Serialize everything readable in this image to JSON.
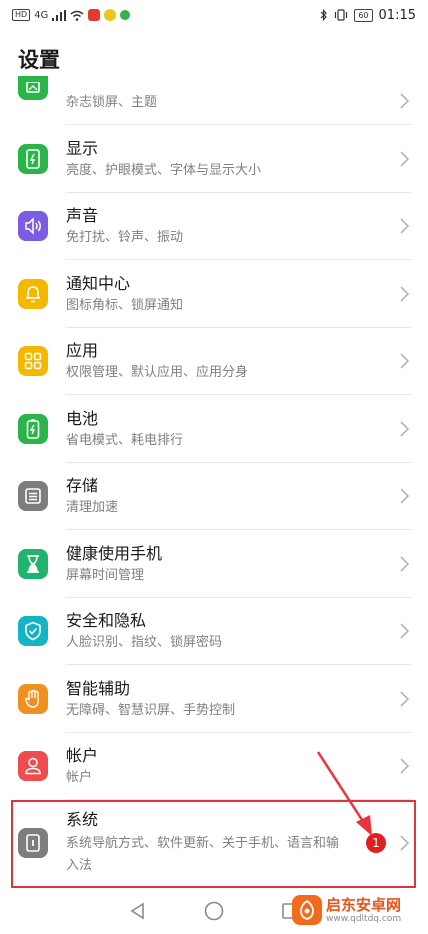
{
  "status_bar": {
    "sim_badge": "HD",
    "signal": "4G",
    "battery": "60",
    "time": "01:15"
  },
  "header": {
    "title": "设置"
  },
  "settings": {
    "items": [
      {
        "title": "",
        "subtitle": "杂志锁屏、主题",
        "icon": "magazine-icon",
        "color": "#2bb44a"
      },
      {
        "title": "显示",
        "subtitle": "亮度、护眼模式、字体与显示大小",
        "icon": "display-icon",
        "color": "#2bb44a"
      },
      {
        "title": "声音",
        "subtitle": "免打扰、铃声、振动",
        "icon": "speaker-icon",
        "color": "#7c5ce0"
      },
      {
        "title": "通知中心",
        "subtitle": "图标角标、锁屏通知",
        "icon": "bell-icon",
        "color": "#f5b800"
      },
      {
        "title": "应用",
        "subtitle": "权限管理、默认应用、应用分身",
        "icon": "apps-grid-icon",
        "color": "#f5b800"
      },
      {
        "title": "电池",
        "subtitle": "省电模式、耗电排行",
        "icon": "battery-icon",
        "color": "#2bb44a"
      },
      {
        "title": "存储",
        "subtitle": "清理加速",
        "icon": "storage-icon",
        "color": "#7d7d7d"
      },
      {
        "title": "健康使用手机",
        "subtitle": "屏幕时间管理",
        "icon": "hourglass-icon",
        "color": "#1fb36c"
      },
      {
        "title": "安全和隐私",
        "subtitle": "人脸识别、指纹、锁屏密码",
        "icon": "shield-icon",
        "color": "#14b4c4"
      },
      {
        "title": "智能辅助",
        "subtitle": "无障碍、智慧识屏、手势控制",
        "icon": "hand-icon",
        "color": "#f0901e"
      },
      {
        "title": "帐户",
        "subtitle": "帐户",
        "icon": "user-icon",
        "color": "#ef4d4d"
      },
      {
        "title": "系统",
        "subtitle": "系统导航方式、软件更新、关于手机、语言和输入法",
        "icon": "system-icon",
        "color": "#7d7d7d",
        "badge": "1"
      }
    ]
  },
  "watermark": {
    "name": "启东安卓网",
    "url": "www.qdltdq.com"
  }
}
